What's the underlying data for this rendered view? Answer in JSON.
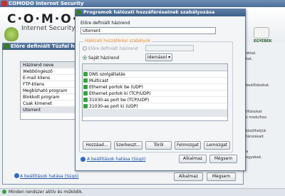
{
  "main": {
    "title": "COMODO Internet Security",
    "logo": "C·O·M·O·D·O",
    "product": "Internet Security",
    "nav_label": "EGYEBEK",
    "right_texts": [
      "okkal.",
      "kat,",
      "beállításokat.",
      "llításokat",
      "s modulhoz.",
      "közölhetjük",
      "tározásait.",
      "a",
      "egyebek."
    ],
    "status": "Minden rendszer aktív és működik."
  },
  "mid_dialog": {
    "title": "Előre definiált Tűzfal házirendek",
    "list_items": [
      "Házirend neve",
      "Webböngésző",
      "E-mail kliens",
      "FTP-kliens",
      "Megbízható program",
      "Blokkolt program",
      "Csak kimenet",
      "Utorrent"
    ],
    "help_link": "A beállítások hatása (Súgó)",
    "apply": "Alkalmaz",
    "cancel": "Mégsem"
  },
  "front_dialog": {
    "title": "Programok hálózati hozzáféréseinek szabályozása",
    "name_label": "Előre definiált házirend",
    "name_value": "Utorrent",
    "group_label": "Hálózati hozzáférési szabályok",
    "radio_predefined": "Előre definiált házirend",
    "radio_custom": "Saját házirend",
    "import_button": "Idemásol",
    "rules": [
      "DNS szolgáltatás",
      "Multicast",
      "Ethernet portok be (UDP)",
      "Ethernet portok ki (TCP/UDP)",
      "31030-as port be (TCP/UDP)",
      "31030-as port ki (UDP)"
    ],
    "buttons": [
      "Hozzáad...",
      "Szerkeszt...",
      "Töröl",
      "Felmozgat",
      "Lemozgat"
    ],
    "help_link": "A beállítások hatása (Súgó)",
    "apply": "Alkalmaz",
    "cancel": "Mégsem"
  }
}
